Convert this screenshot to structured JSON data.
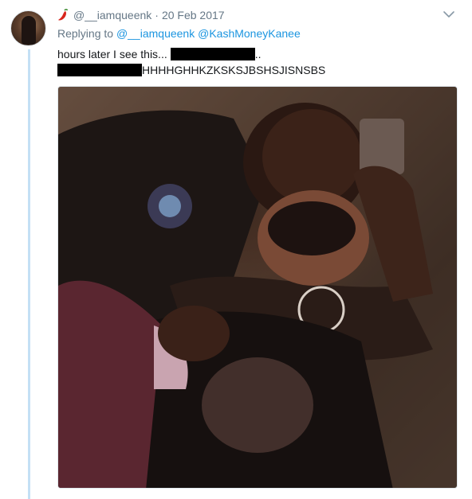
{
  "tweet": {
    "username": "@__iamqueenk",
    "separator": "·",
    "date": "20 Feb 2017",
    "replying_prefix": "Replying to",
    "mentions": [
      "@__iamqueenk",
      "@KashMoneyKanee"
    ],
    "line1_text": "hours later I see this...",
    "line1_suffix": "..",
    "line2_text": "HHHHGHHKZKSKSJBSHSJISNSBS"
  },
  "icons": {
    "name_emoji": "chili-pepper-icon",
    "menu": "chevron-down-icon"
  },
  "colors": {
    "link": "#1b95e0",
    "muted": "#657786",
    "thread_line": "#c4e0f5"
  }
}
